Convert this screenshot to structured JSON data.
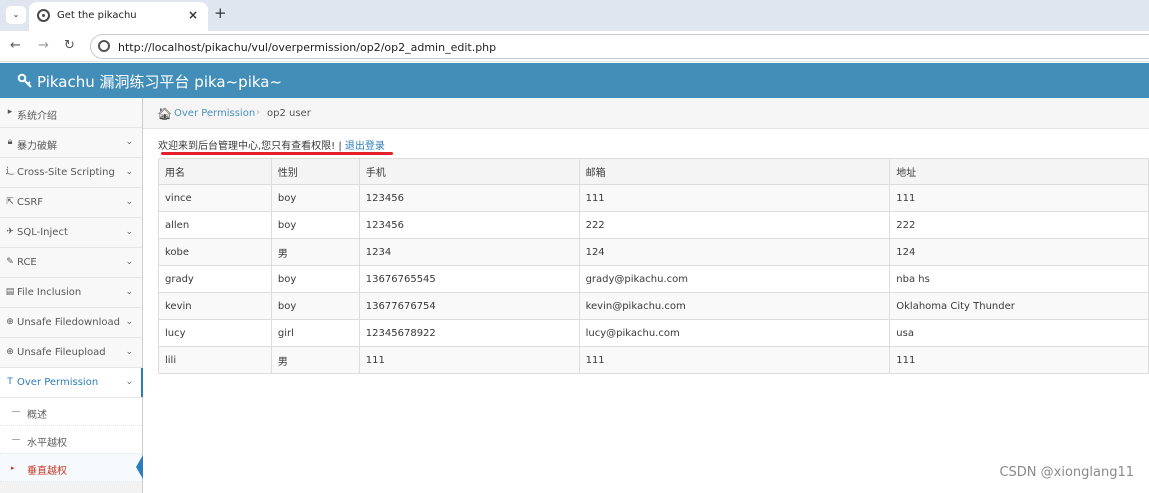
{
  "browser": {
    "tab_title": "Get the pikachu",
    "tab_close": "×",
    "new_tab": "+",
    "tab_menu": "⌄",
    "url": "http://localhost/pikachu/vul/overpermission/op2/op2_admin_edit.php"
  },
  "app": {
    "title": "Pikachu 漏洞练习平台 pika~pika~",
    "header_color": "#438eb9",
    "accent_color": "#2b7dbc"
  },
  "sidebar": {
    "items": [
      {
        "label": "系统介绍",
        "icon": "desktop-icon",
        "glyph": "▸",
        "chevron": ""
      },
      {
        "label": "暴力破解",
        "icon": "lock-icon",
        "glyph": "🔒︎",
        "chevron": "⌄"
      },
      {
        "label": "Cross-Site Scripting",
        "icon": "xss-icon",
        "glyph": "⻌",
        "chevron": "⌄"
      },
      {
        "label": "CSRF",
        "icon": "share-icon",
        "glyph": "⇱",
        "chevron": "⌄"
      },
      {
        "label": "SQL-Inject",
        "icon": "plane-icon",
        "glyph": "✈",
        "chevron": "⌄"
      },
      {
        "label": "RCE",
        "icon": "pencil-icon",
        "glyph": "✎",
        "chevron": "⌄"
      },
      {
        "label": "File Inclusion",
        "icon": "file-icon",
        "glyph": "▤",
        "chevron": "⌄"
      },
      {
        "label": "Unsafe Filedownload",
        "icon": "download-icon",
        "glyph": "⊕",
        "chevron": "⌄"
      },
      {
        "label": "Unsafe Fileupload",
        "icon": "upload-icon",
        "glyph": "⊕",
        "chevron": "⌄"
      },
      {
        "label": "Over Permission",
        "icon": "text-cursor-icon",
        "glyph": "T",
        "chevron": "⌄"
      }
    ],
    "sub_items": [
      {
        "label": "概述"
      },
      {
        "label": "水平越权"
      },
      {
        "label": "垂直越权"
      }
    ]
  },
  "breadcrumb": {
    "link": "Over Permission",
    "separator": "›",
    "current": "op2 user"
  },
  "welcome": {
    "text": "欢迎来到后台管理中心,您只有查看权限! | ",
    "logout": "退出登录"
  },
  "table": {
    "headers": [
      "用名",
      "性别",
      "手机",
      "邮箱",
      "地址"
    ],
    "rows": [
      [
        "vince",
        "boy",
        "123456",
        "111",
        "111"
      ],
      [
        "allen",
        "boy",
        "123456",
        "222",
        "222"
      ],
      [
        "kobe",
        "男",
        "1234",
        "124",
        "124"
      ],
      [
        "grady",
        "boy",
        "13676765545",
        "grady@pikachu.com",
        "nba hs"
      ],
      [
        "kevin",
        "boy",
        "13677676754",
        "kevin@pikachu.com",
        "Oklahoma City Thunder"
      ],
      [
        "lucy",
        "girl",
        "12345678922",
        "lucy@pikachu.com",
        "usa"
      ],
      [
        "lili",
        "男",
        "111",
        "111",
        "111"
      ]
    ]
  },
  "watermark": "CSDN @xionglang11"
}
